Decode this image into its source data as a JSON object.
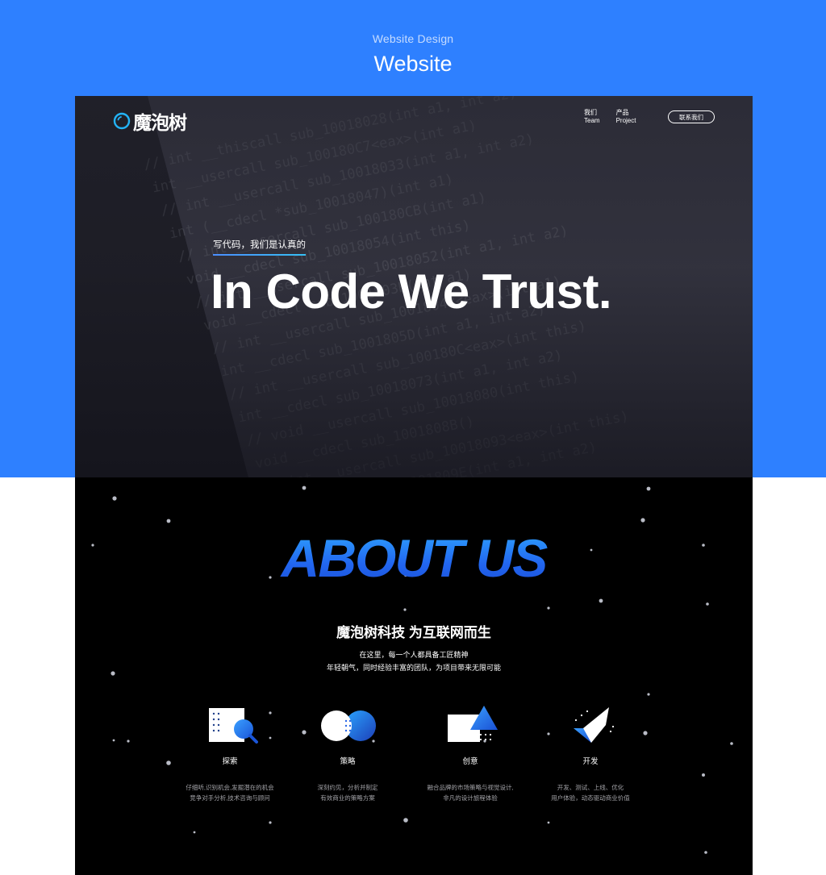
{
  "showcase": {
    "subtitle": "Website Design",
    "title": "Website"
  },
  "hero": {
    "logo_text": "魔泡树",
    "nav": [
      {
        "cn": "我们",
        "en": "Team"
      },
      {
        "cn": "产品",
        "en": "Project"
      }
    ],
    "contact_button": "联系我们",
    "eyebrow": "写代码，我们是认真的",
    "headline": "In Code We Trust."
  },
  "about": {
    "title": "ABOUT US",
    "heading": "魔泡树科技 为互联网而生",
    "desc_lines": [
      "在这里，每一个人都具备工匠精神",
      "年轻朝气，同时经验丰富的团队，为项目带来无限可能"
    ],
    "features": [
      {
        "icon": "explore-magnifier-icon",
        "label": "探索",
        "desc": [
          "仔细听,识别机会,发掘潜在的机会",
          "竞争对手分析,技术咨询与顾问"
        ]
      },
      {
        "icon": "strategy-circles-icon",
        "label": "策略",
        "desc": [
          "深刻约见，分析并制定",
          "有效商业的策略方案"
        ]
      },
      {
        "icon": "creative-triangle-icon",
        "label": "创意",
        "desc": [
          "融合品牌的市场策略与视觉设计,",
          "非凡的设计旅程体验"
        ]
      },
      {
        "icon": "develop-check-icon",
        "label": "开发",
        "desc": [
          "开发、测试、上线、优化",
          "用户体验，动态驱动商业价值"
        ]
      }
    ]
  },
  "colors": {
    "band_blue": "#2e80ff",
    "accent_blue": "#2266f0",
    "hero_bg": "#2c2c36",
    "about_bg": "#000000"
  }
}
